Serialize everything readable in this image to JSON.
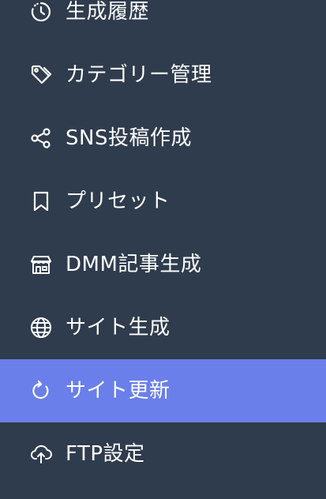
{
  "sidebar": {
    "active_bg": "#6a7fea",
    "bg": "#2f3c4d",
    "items": [
      {
        "label": "生成履歴",
        "icon": "history-icon",
        "active": false
      },
      {
        "label": "カテゴリー管理",
        "icon": "tag-icon",
        "active": false
      },
      {
        "label": "SNS投稿作成",
        "icon": "share-icon",
        "active": false
      },
      {
        "label": "プリセット",
        "icon": "bookmark-icon",
        "active": false
      },
      {
        "label": "DMM記事生成",
        "icon": "store-icon",
        "active": false
      },
      {
        "label": "サイト生成",
        "icon": "globe-icon",
        "active": false
      },
      {
        "label": "サイト更新",
        "icon": "refresh-icon",
        "active": true
      },
      {
        "label": "FTP設定",
        "icon": "cloud-upload-icon",
        "active": false
      }
    ]
  }
}
